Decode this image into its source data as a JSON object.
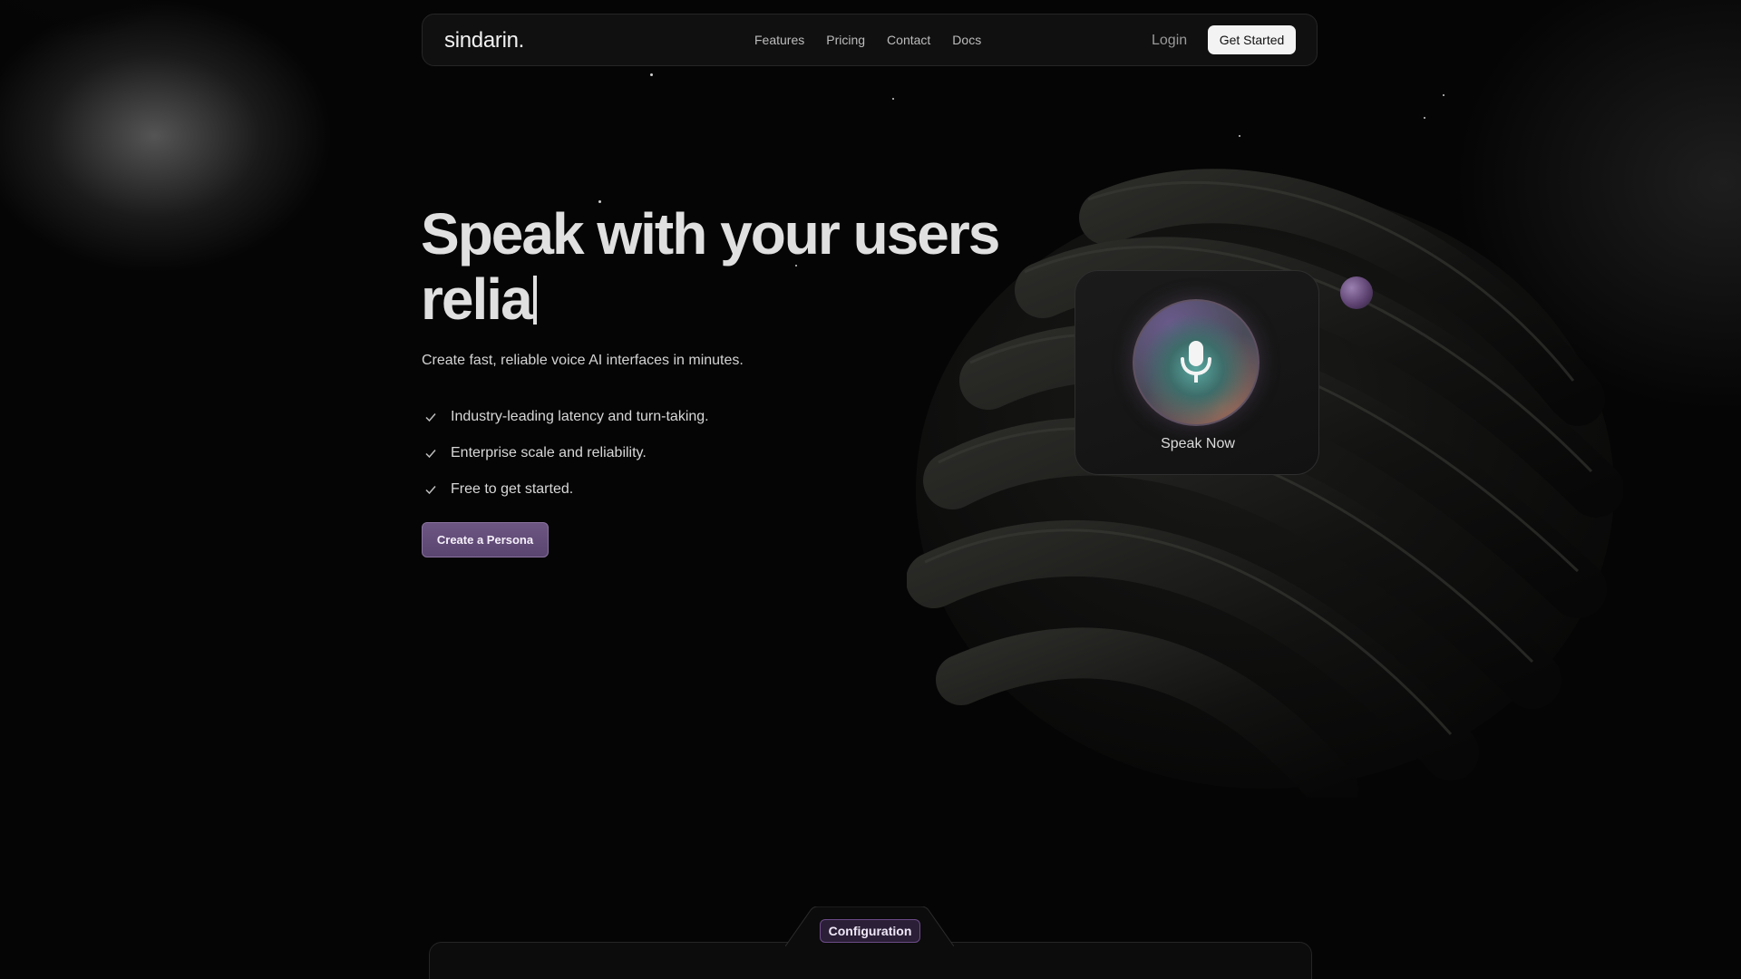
{
  "nav": {
    "logo": "sindarin.",
    "links": [
      "Features",
      "Pricing",
      "Contact",
      "Docs"
    ],
    "login_label": "Login",
    "get_started_label": "Get Started"
  },
  "hero": {
    "headline_line1": "Speak with your users",
    "headline_line2": "relia",
    "subtitle": "Create fast, reliable voice AI interfaces in minutes.",
    "features": [
      "Industry-leading latency and turn-taking.",
      "Enterprise scale and reliability.",
      "Free to get started."
    ],
    "cta_label": "Create a Persona"
  },
  "voice_widget": {
    "label": "Speak Now",
    "icon": "microphone-icon"
  },
  "config": {
    "tab_label": "Configuration"
  },
  "colors": {
    "background": "#050505",
    "accent_purple": "#6d5682",
    "text": "#e0e0e0"
  }
}
